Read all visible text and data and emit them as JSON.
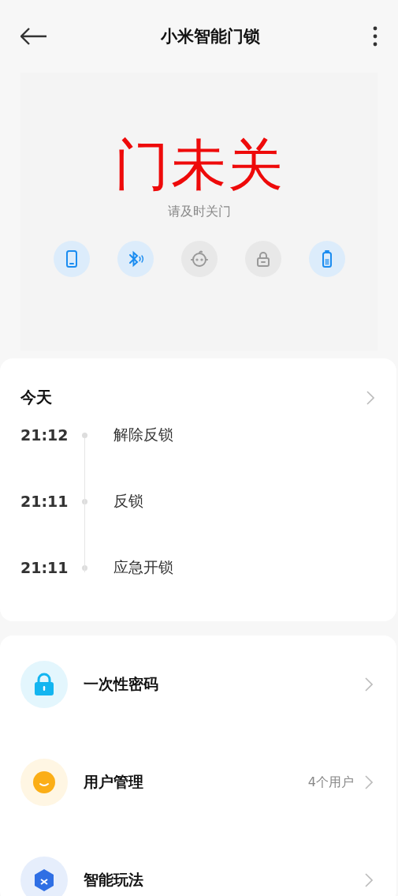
{
  "header": {
    "title": "小米智能门锁"
  },
  "status": {
    "headline": "门未关",
    "hint": "请及时关门",
    "indicators": [
      {
        "kind": "phone",
        "on": true
      },
      {
        "kind": "bluetooth",
        "on": true
      },
      {
        "kind": "child",
        "on": false
      },
      {
        "kind": "lock",
        "on": false
      },
      {
        "kind": "battery",
        "on": true
      }
    ]
  },
  "log": {
    "title": "今天",
    "entries": [
      {
        "time": "21:12",
        "event": "解除反锁"
      },
      {
        "time": "21:11",
        "event": "反锁"
      },
      {
        "time": "21:11",
        "event": "应急开锁"
      }
    ]
  },
  "menu": [
    {
      "kind": "password",
      "label": "一次性密码"
    },
    {
      "kind": "users",
      "label": "用户管理",
      "value": "4个用户"
    },
    {
      "kind": "smart",
      "label": "智能玩法"
    }
  ]
}
